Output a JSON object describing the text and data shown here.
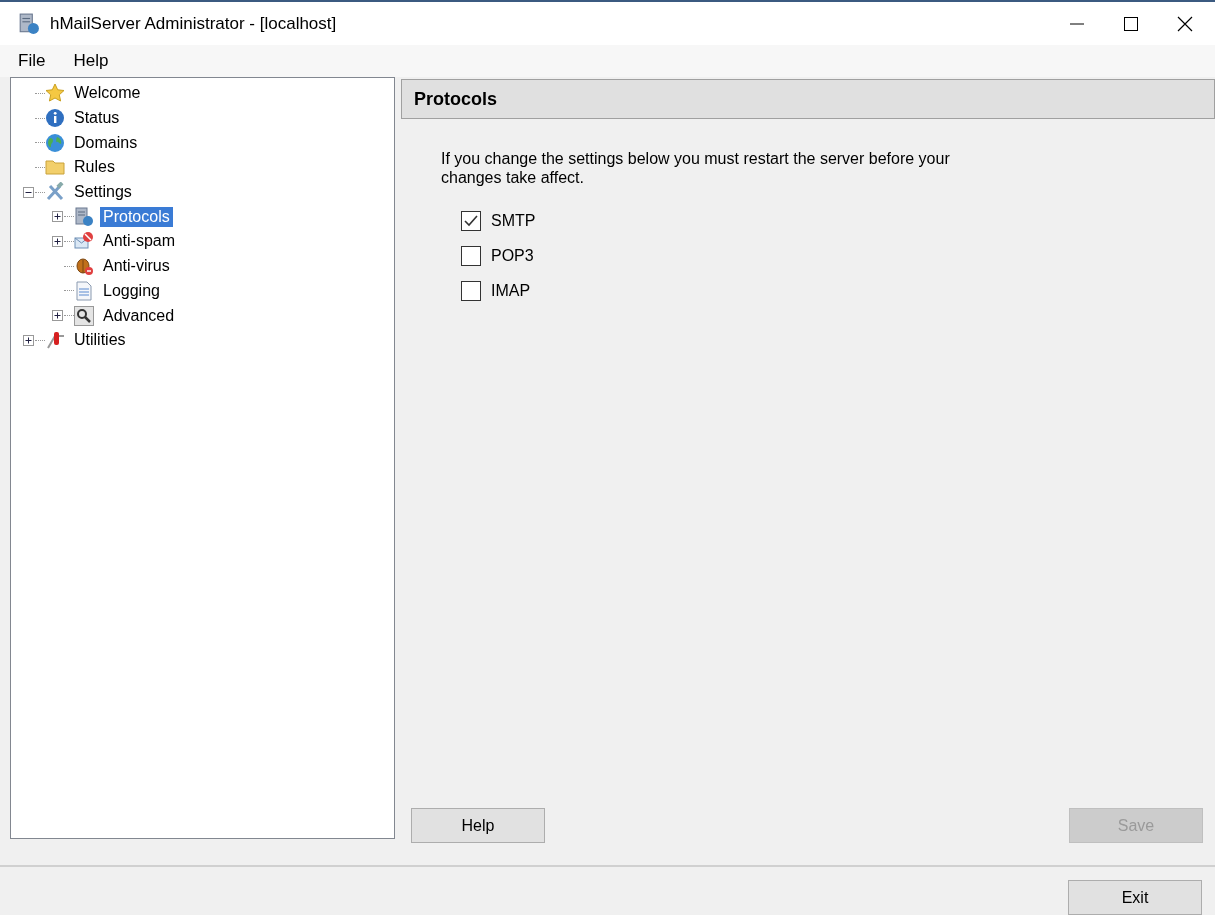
{
  "window": {
    "title": "hMailServer Administrator - [localhost]"
  },
  "menu": [
    "File",
    "Help"
  ],
  "tree": [
    {
      "label": "Welcome",
      "kind": "star",
      "selected": false
    },
    {
      "label": "Status",
      "kind": "info",
      "selected": false
    },
    {
      "label": "Domains",
      "kind": "globe",
      "selected": false
    },
    {
      "label": "Rules",
      "kind": "folder",
      "selected": false
    },
    {
      "label": "Settings",
      "kind": "tools",
      "expanded": true,
      "selected": false,
      "children": [
        {
          "label": "Protocols",
          "kind": "server",
          "expanded": false,
          "selected": true
        },
        {
          "label": "Anti-spam",
          "kind": "mail",
          "expanded": false,
          "selected": false
        },
        {
          "label": "Anti-virus",
          "kind": "bug",
          "selected": false
        },
        {
          "label": "Logging",
          "kind": "log",
          "selected": false
        },
        {
          "label": "Advanced",
          "kind": "magnifier",
          "expanded": false,
          "selected": false
        }
      ]
    },
    {
      "label": "Utilities",
      "kind": "knife",
      "expanded": false,
      "selected": false
    }
  ],
  "panel": {
    "title": "Protocols",
    "note": "If you change the settings below you must restart the server before your changes take affect.",
    "options": [
      {
        "label": "SMTP",
        "checked": true
      },
      {
        "label": "POP3",
        "checked": false
      },
      {
        "label": "IMAP",
        "checked": false
      }
    ],
    "buttons": [
      {
        "label": "Help",
        "disabled": false
      },
      {
        "label": "Save",
        "disabled": true
      }
    ]
  },
  "footer": {
    "button": "Exit"
  }
}
